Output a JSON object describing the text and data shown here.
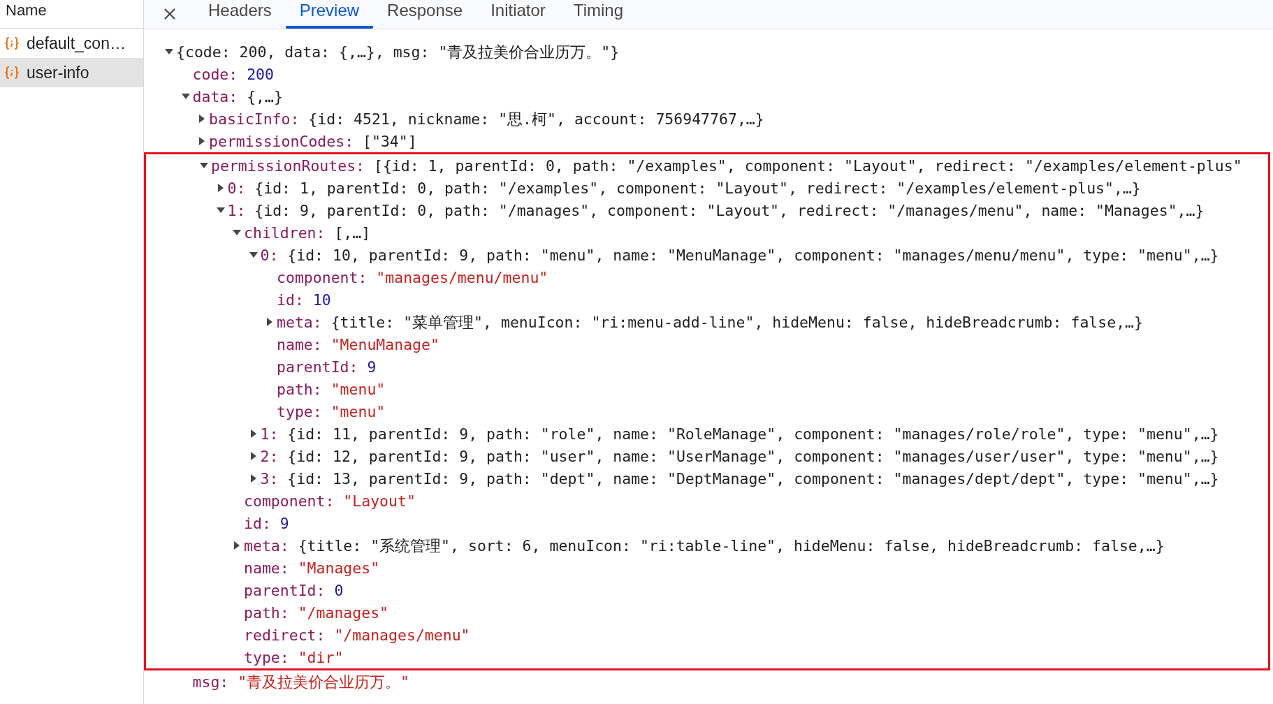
{
  "sidebar": {
    "header": "Name",
    "items": [
      {
        "label": "default_con…",
        "selected": false
      },
      {
        "label": "user-info",
        "selected": true
      }
    ]
  },
  "tabs": [
    {
      "label": "Headers",
      "selected": false
    },
    {
      "label": "Preview",
      "selected": true
    },
    {
      "label": "Response",
      "selected": false
    },
    {
      "label": "Initiator",
      "selected": false
    },
    {
      "label": "Timing",
      "selected": false
    }
  ],
  "tree": {
    "kind": "object",
    "expanded": true,
    "value": "{code: 200, data: {,…}, msg: \"青及拉美价合业历万。\"}",
    "children": [
      {
        "key": "code:",
        "kind": "number",
        "value": "200"
      },
      {
        "key": "data:",
        "kind": "object",
        "expanded": true,
        "value": "{,…}",
        "children": [
          {
            "key": "basicInfo:",
            "kind": "object",
            "expanded": false,
            "value": "{id: 4521, nickname: \"思.柯\", account: 756947767,…}"
          },
          {
            "key": "permissionCodes:",
            "kind": "object",
            "expanded": false,
            "value": "[\"34\"]"
          },
          {
            "key": "permissionRoutes:",
            "kind": "object",
            "expanded": true,
            "highlighted": true,
            "value": "[{id: 1, parentId: 0, path: \"/examples\", component: \"Layout\", redirect: \"/examples/element-plus\"",
            "children": [
              {
                "key": "0:",
                "kind": "object",
                "expanded": false,
                "value": "{id: 1, parentId: 0, path: \"/examples\", component: \"Layout\", redirect: \"/examples/element-plus\",…}"
              },
              {
                "key": "1:",
                "kind": "object",
                "expanded": true,
                "value": "{id: 9, parentId: 0, path: \"/manages\", component: \"Layout\", redirect: \"/manages/menu\", name: \"Manages\",…}",
                "children": [
                  {
                    "key": "children:",
                    "kind": "object",
                    "expanded": true,
                    "value": "[,…]",
                    "children": [
                      {
                        "key": "0:",
                        "kind": "object",
                        "expanded": true,
                        "value": "{id: 10, parentId: 9, path: \"menu\", name: \"MenuManage\", component: \"manages/menu/menu\", type: \"menu\",…}",
                        "children": [
                          {
                            "key": "component:",
                            "kind": "string",
                            "value": "\"manages/menu/menu\""
                          },
                          {
                            "key": "id:",
                            "kind": "number",
                            "value": "10"
                          },
                          {
                            "key": "meta:",
                            "kind": "object",
                            "expanded": false,
                            "value": "{title: \"菜单管理\", menuIcon: \"ri:menu-add-line\", hideMenu: false, hideBreadcrumb: false,…}"
                          },
                          {
                            "key": "name:",
                            "kind": "string",
                            "value": "\"MenuManage\""
                          },
                          {
                            "key": "parentId:",
                            "kind": "number",
                            "value": "9"
                          },
                          {
                            "key": "path:",
                            "kind": "string",
                            "value": "\"menu\""
                          },
                          {
                            "key": "type:",
                            "kind": "string",
                            "value": "\"menu\""
                          }
                        ]
                      },
                      {
                        "key": "1:",
                        "kind": "object",
                        "expanded": false,
                        "value": "{id: 11, parentId: 9, path: \"role\", name: \"RoleManage\", component: \"manages/role/role\", type: \"menu\",…}"
                      },
                      {
                        "key": "2:",
                        "kind": "object",
                        "expanded": false,
                        "value": "{id: 12, parentId: 9, path: \"user\", name: \"UserManage\", component: \"manages/user/user\", type: \"menu\",…}"
                      },
                      {
                        "key": "3:",
                        "kind": "object",
                        "expanded": false,
                        "value": "{id: 13, parentId: 9, path: \"dept\", name: \"DeptManage\", component: \"manages/dept/dept\", type: \"menu\",…}"
                      }
                    ]
                  },
                  {
                    "key": "component:",
                    "kind": "string",
                    "value": "\"Layout\""
                  },
                  {
                    "key": "id:",
                    "kind": "number",
                    "value": "9"
                  },
                  {
                    "key": "meta:",
                    "kind": "object",
                    "expanded": false,
                    "value": "{title: \"系统管理\", sort: 6, menuIcon: \"ri:table-line\", hideMenu: false, hideBreadcrumb: false,…}"
                  },
                  {
                    "key": "name:",
                    "kind": "string",
                    "value": "\"Manages\""
                  },
                  {
                    "key": "parentId:",
                    "kind": "number",
                    "value": "0"
                  },
                  {
                    "key": "path:",
                    "kind": "string",
                    "value": "\"/manages\""
                  },
                  {
                    "key": "redirect:",
                    "kind": "string",
                    "value": "\"/manages/menu\""
                  },
                  {
                    "key": "type:",
                    "kind": "string",
                    "value": "\"dir\""
                  }
                ]
              }
            ]
          }
        ]
      },
      {
        "key": "msg:",
        "kind": "string",
        "value": "\"青及拉美价合业历万。\""
      }
    ]
  }
}
